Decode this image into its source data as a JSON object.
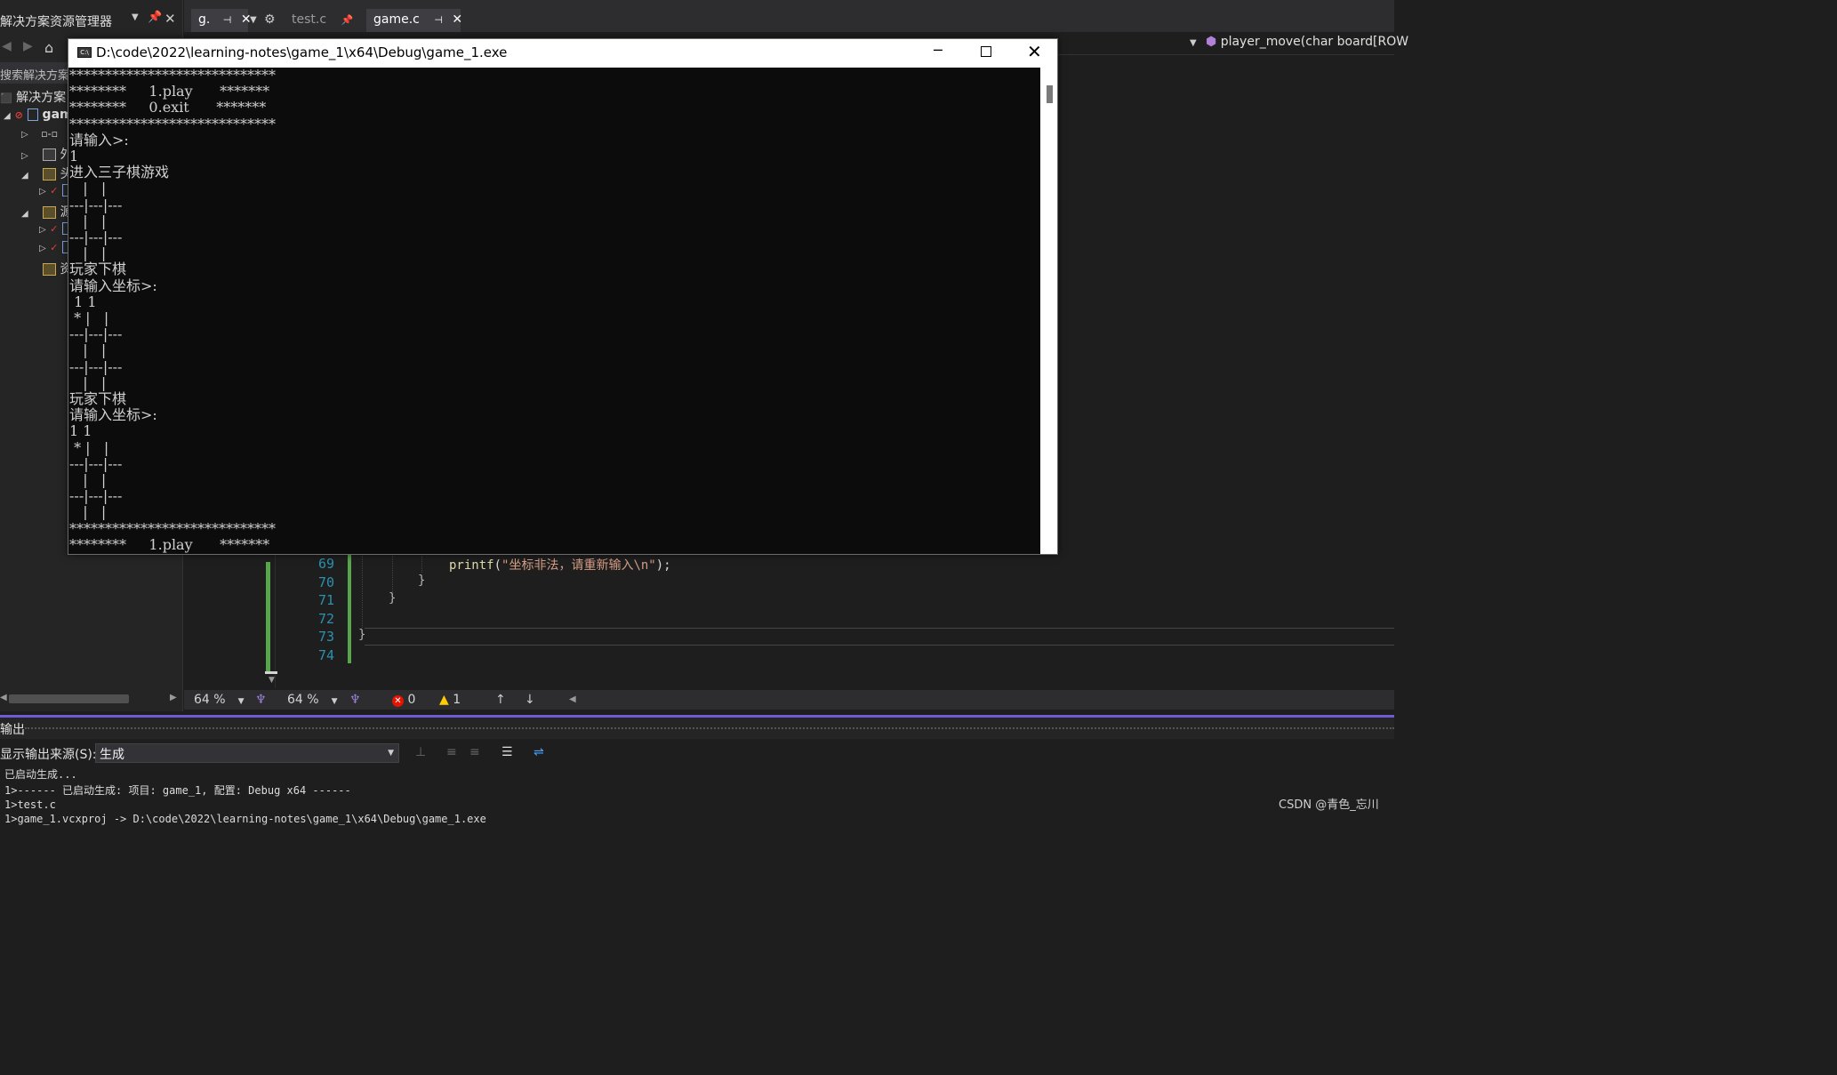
{
  "solution_explorer": {
    "title": "解决方案资源管理器",
    "search_placeholder": "搜索解决方案",
    "tree": [
      {
        "label": "解决方案",
        "level": 0
      },
      {
        "label": "gam",
        "level": 1
      },
      {
        "label": "",
        "level": 2,
        "kind": "references"
      },
      {
        "label": "外",
        "level": 2,
        "kind": "external"
      },
      {
        "label": "头",
        "level": 2,
        "kind": "filter"
      },
      {
        "label": "",
        "level": 3,
        "kind": "header-file"
      },
      {
        "label": "源",
        "level": 2,
        "kind": "filter"
      },
      {
        "label": "",
        "level": 3,
        "kind": "source-file"
      },
      {
        "label": "",
        "level": 3,
        "kind": "source-file"
      },
      {
        "label": "资",
        "level": 2,
        "kind": "filter"
      }
    ]
  },
  "tabs": {
    "items": [
      {
        "label": "g.",
        "active": true
      },
      {
        "label": "test.c",
        "active": false
      },
      {
        "label": "game.c",
        "active": true
      }
    ]
  },
  "navbar": {
    "function": "player_move(char board[ROW"
  },
  "editor": {
    "line_numbers": [
      "69",
      "70",
      "71",
      "72",
      "73",
      "74"
    ],
    "code": {
      "printf_fn": "printf",
      "printf_open": "(",
      "printf_str": "\"坐标非法，请重新输入\\n\"",
      "printf_close": ");",
      "brace70": "}",
      "brace71": "}",
      "brace73": "}"
    },
    "zoom_left": "64 %",
    "zoom_right": "64 %",
    "errors": "0",
    "warnings": "1"
  },
  "output": {
    "title": "输出",
    "source_label": "显示输出来源(S):",
    "source_value": "生成",
    "lines": [
      "已启动生成...",
      "1>------ 已启动生成: 项目: game_1, 配置: Debug x64 ------",
      "1>test.c",
      "1>game_1.vcxproj -> D:\\code\\2022\\learning-notes\\game_1\\x64\\Debug\\game_1.exe"
    ]
  },
  "console": {
    "title": "D:\\code\\2022\\learning-notes\\game_1\\x64\\Debug\\game_1.exe",
    "lines": [
      "*****************************",
      "********     1.play      *******",
      "********     0.exit      *******",
      "*****************************",
      "请输入>:",
      "1",
      "进入三子棋游戏",
      "   |   |   ",
      "---|---|---",
      "   |   |   ",
      "---|---|---",
      "   |   |   ",
      "玩家下棋",
      "请输入坐标>:",
      " 1 1",
      " * |   |   ",
      "---|---|---",
      "   |   |   ",
      "---|---|---",
      "   |   |   ",
      "玩家下棋",
      "请输入坐标>:",
      "1 1",
      " * |   |   ",
      "---|---|---",
      "   |   |   ",
      "---|---|---",
      "   |   |   ",
      "*****************************",
      "********     1.play      *******"
    ]
  },
  "watermark": "CSDN @青色_忘川"
}
